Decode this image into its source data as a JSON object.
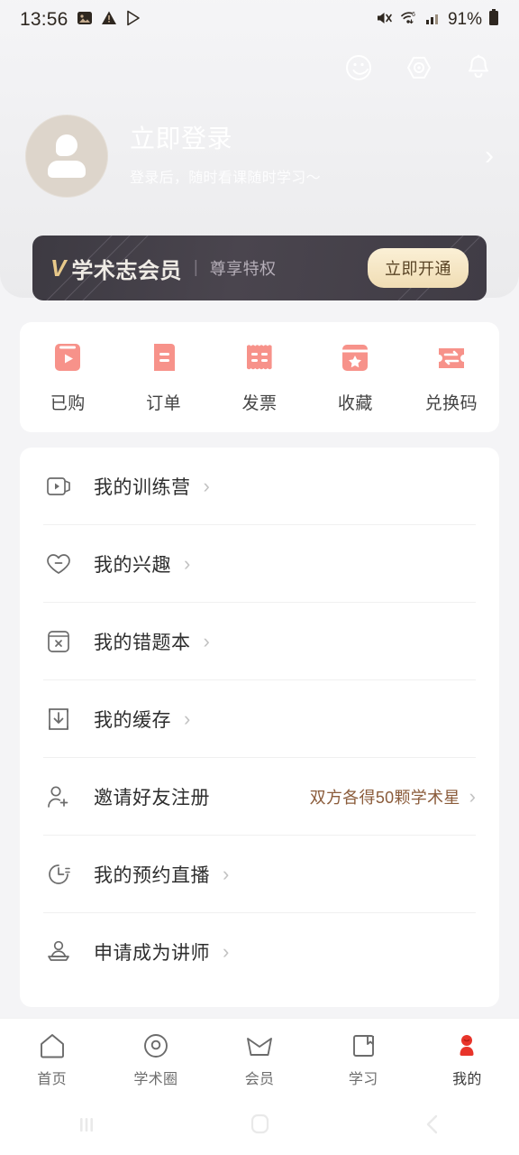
{
  "status_bar": {
    "time": "13:56",
    "left_icons": [
      "image-icon",
      "warning-icon",
      "play-store-icon"
    ],
    "battery_percent": "91%",
    "right_icons": [
      "mute-icon",
      "wifi-icon",
      "signal-icon",
      "battery-icon"
    ]
  },
  "header": {
    "icons": [
      {
        "name": "smiley-icon"
      },
      {
        "name": "settings-hexagon-icon"
      },
      {
        "name": "bell-icon"
      }
    ],
    "profile": {
      "title": "立即登录",
      "subtitle": "登录后，随时看课随时学习～",
      "arrow": "›",
      "avatar_icon": "default-avatar-icon"
    },
    "vip": {
      "logo": "V",
      "name": "学术志会员",
      "divider": "|",
      "subtitle": "尊享特权",
      "button_label": "立即开通",
      "bg_color": "#443f48",
      "button_color": "#f4e2ba",
      "logo_color": "#e8c98a"
    },
    "bg_color": "#c6ad90"
  },
  "quick_actions": [
    {
      "label": "已购",
      "icon": "purchased-play-icon"
    },
    {
      "label": "订单",
      "icon": "order-document-icon"
    },
    {
      "label": "发票",
      "icon": "invoice-receipt-icon"
    },
    {
      "label": "收藏",
      "icon": "favorite-star-box-icon"
    },
    {
      "label": "兑换码",
      "icon": "redeem-code-icon"
    }
  ],
  "accent_color": "#f39287",
  "menu_items": [
    {
      "label": "我的训练营",
      "icon": "training-camp-icon",
      "extra": "",
      "arrow": "›"
    },
    {
      "label": "我的兴趣",
      "icon": "heart-icon",
      "extra": "",
      "arrow": "›"
    },
    {
      "label": "我的错题本",
      "icon": "wrong-question-book-icon",
      "extra": "",
      "arrow": "›"
    },
    {
      "label": "我的缓存",
      "icon": "download-cache-icon",
      "extra": "",
      "arrow": "›"
    },
    {
      "label": "邀请好友注册",
      "icon": "invite-friend-icon",
      "extra": "双方各得50颗学术星",
      "arrow": "›"
    },
    {
      "label": "我的预约直播",
      "icon": "clock-live-icon",
      "extra": "",
      "arrow": "›"
    },
    {
      "label": "申请成为讲师",
      "icon": "lecturer-icon",
      "extra": "",
      "arrow": "›"
    }
  ],
  "invite_highlight_color": "#8b5c3b",
  "tabbar": {
    "items": [
      {
        "label": "首页",
        "icon": "home-icon",
        "active": false
      },
      {
        "label": "学术圈",
        "icon": "academic-circle-icon",
        "active": false
      },
      {
        "label": "会员",
        "icon": "crown-membership-icon",
        "active": false
      },
      {
        "label": "学习",
        "icon": "book-study-icon",
        "active": false
      },
      {
        "label": "我的",
        "icon": "profile-person-icon",
        "active": true
      }
    ],
    "active_color": "#e8342a"
  },
  "android_nav": {
    "recents_label": "recent-apps-icon",
    "home_label": "home-button-icon",
    "back_label": "back-button-icon"
  }
}
